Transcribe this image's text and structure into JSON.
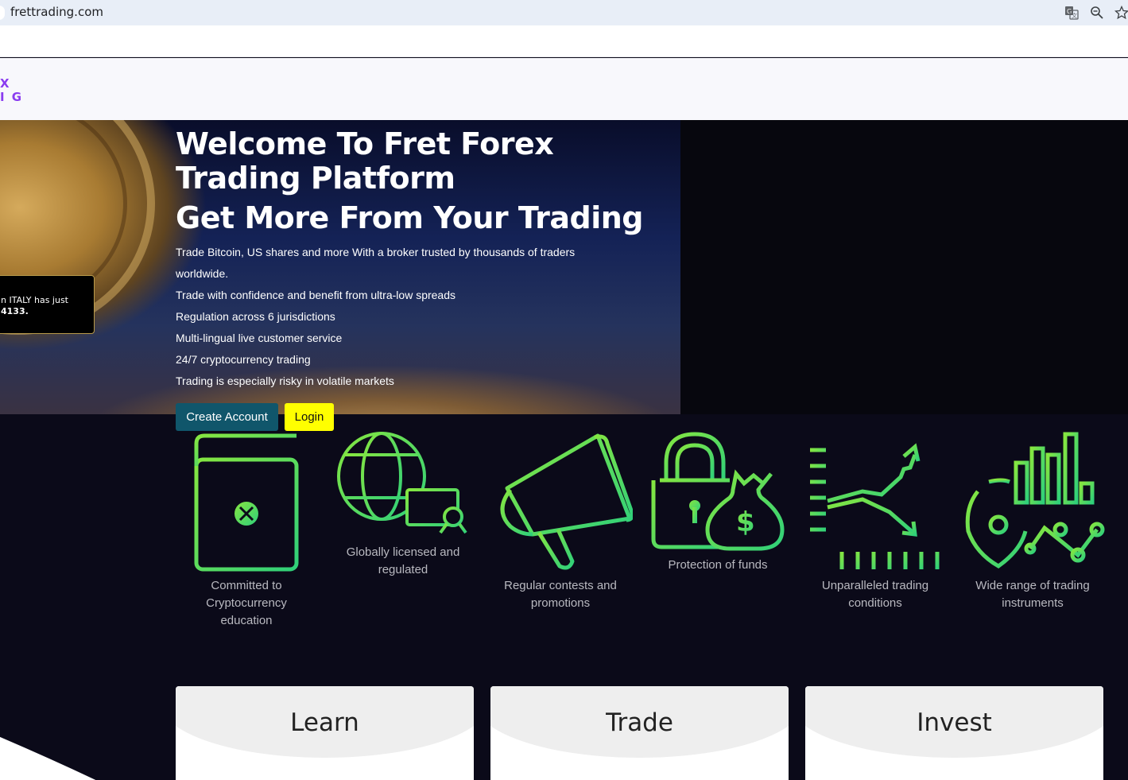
{
  "browser": {
    "url": "frettrading.com",
    "icons": [
      "translate-icon",
      "zoom-icon",
      "bookmark-star-icon"
    ]
  },
  "logo": {
    "line1": "X",
    "line2": "I G",
    "color": "#8a3cf0"
  },
  "hero": {
    "title": "Welcome To Fret Forex Trading Platform",
    "subtitle": "Get More From Your Trading",
    "points": [
      "Trade Bitcoin, US shares and more With a broker trusted by thousands of traders worldwide.",
      "Trade with confidence and benefit from ultra-low spreads",
      "Regulation across 6 jurisdictions",
      "Multi-lingual live customer service",
      "24/7 cryptocurrency trading",
      "Trading is especially risky in volatile markets"
    ],
    "create_label": "Create Account",
    "login_label": "Login"
  },
  "toast": {
    "line1": "n ITALY has just",
    "line2": "4133."
  },
  "features": [
    {
      "icon": "book-icon",
      "label": "Committed to Cryptocurrency education"
    },
    {
      "icon": "globe-certificate-icon",
      "label": "Globally licensed and regulated"
    },
    {
      "icon": "megaphone-icon",
      "label": "Regular contests and promotions"
    },
    {
      "icon": "lock-money-bag-icon",
      "label": "Protection of funds"
    },
    {
      "icon": "trend-chart-icon",
      "label": "Unparalleled trading conditions"
    },
    {
      "icon": "bar-chart-network-icon",
      "label": "Wide range of trading instruments"
    }
  ],
  "cards": [
    {
      "title": "Learn"
    },
    {
      "title": "Trade"
    },
    {
      "title": "Invest"
    }
  ],
  "colors": {
    "background": "#0b0a19",
    "icon_green_start": "#7ee44a",
    "icon_green_end": "#2fd37a",
    "create_button": "#10566b",
    "login_button": "#ffff00"
  }
}
